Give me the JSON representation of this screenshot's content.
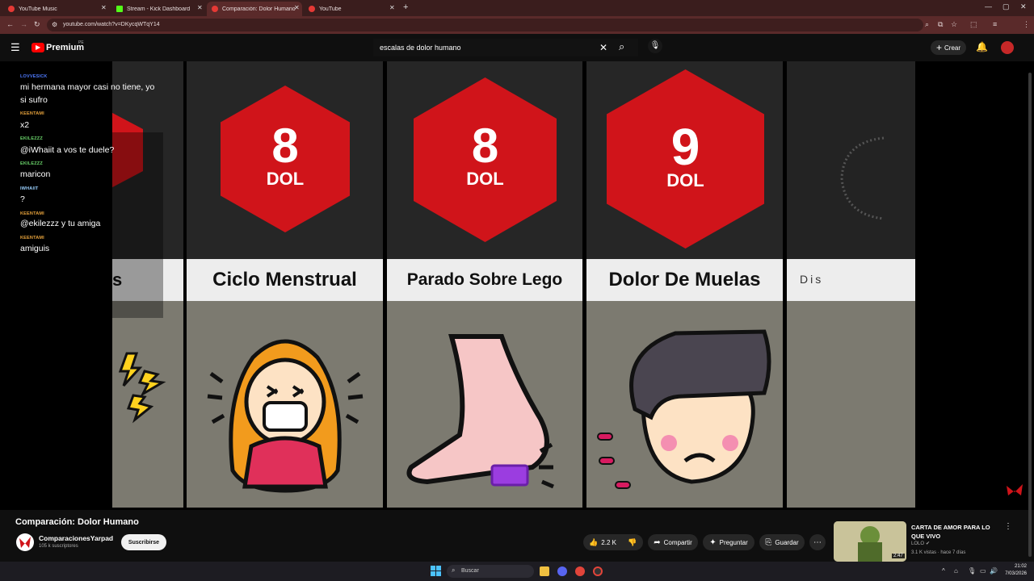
{
  "browser": {
    "tabs": [
      {
        "label": "YouTube Music",
        "active": false,
        "color": "#e53935"
      },
      {
        "label": "Stream - Kick Dashboard",
        "active": false,
        "color": "#53fc18"
      },
      {
        "label": "Comparación: Dolor Humano",
        "active": true,
        "color": "#e53935"
      },
      {
        "label": "YouTube",
        "active": false,
        "color": "#e53935"
      }
    ],
    "url": "youtube.com/watch?v=DKycqWTqY14"
  },
  "youtube": {
    "logo": "Premium",
    "logo_badge": "PE",
    "search_value": "escalas de dolor humano",
    "create_label": "Crear"
  },
  "video": {
    "cards": [
      {
        "title": "s",
        "value": "",
        "unit": ""
      },
      {
        "title": "Ciclo Menstrual",
        "value": "8",
        "unit": "DOL"
      },
      {
        "title": "Parado Sobre Lego",
        "value": "8",
        "unit": "DOL"
      },
      {
        "title": "Dolor De Muelas",
        "value": "9",
        "unit": "DOL"
      },
      {
        "title": "Dis",
        "value": "",
        "unit": ""
      }
    ],
    "chat": [
      {
        "user": "LOVVESICK",
        "msg": "mi hermana mayor casi no tiene, yo si sufro",
        "color": "#4f7bff"
      },
      {
        "user": "KEENTAMI",
        "msg": "x2",
        "color": "#e8a33c"
      },
      {
        "user": "EKILEZZZ",
        "msg": "@iWhaiit a vos te duele?",
        "color": "#6bd66b"
      },
      {
        "user": "EKILEZZZ",
        "msg": "maricon",
        "color": "#6bd66b"
      },
      {
        "user": "IWHAIIT",
        "msg": "?",
        "color": "#9ad0ff"
      },
      {
        "user": "KEENTAMI",
        "msg": "@ekilezzz y tu amiga",
        "color": "#e8a33c"
      },
      {
        "user": "KEENTAMI",
        "msg": "amiguis",
        "color": "#e8a33c"
      }
    ]
  },
  "meta": {
    "title": "Comparación: Dolor Humano",
    "channel": "ComparacionesYarpad",
    "subscribers": "105 k suscriptores",
    "subscribe_label": "Suscribirse",
    "likes": "2.2 K",
    "share_label": "Compartir",
    "ask_label": "Preguntar",
    "save_label": "Guardar"
  },
  "recommendation": {
    "title": "CARTA DE AMOR PARA LO QUE VIVO",
    "channel": "LOLO",
    "stats": "3.1 K vistas · hace 7 días",
    "duration": "2:47"
  },
  "taskbar": {
    "search_label": "Buscar",
    "time": "21:02",
    "date": "7/03/2026"
  }
}
